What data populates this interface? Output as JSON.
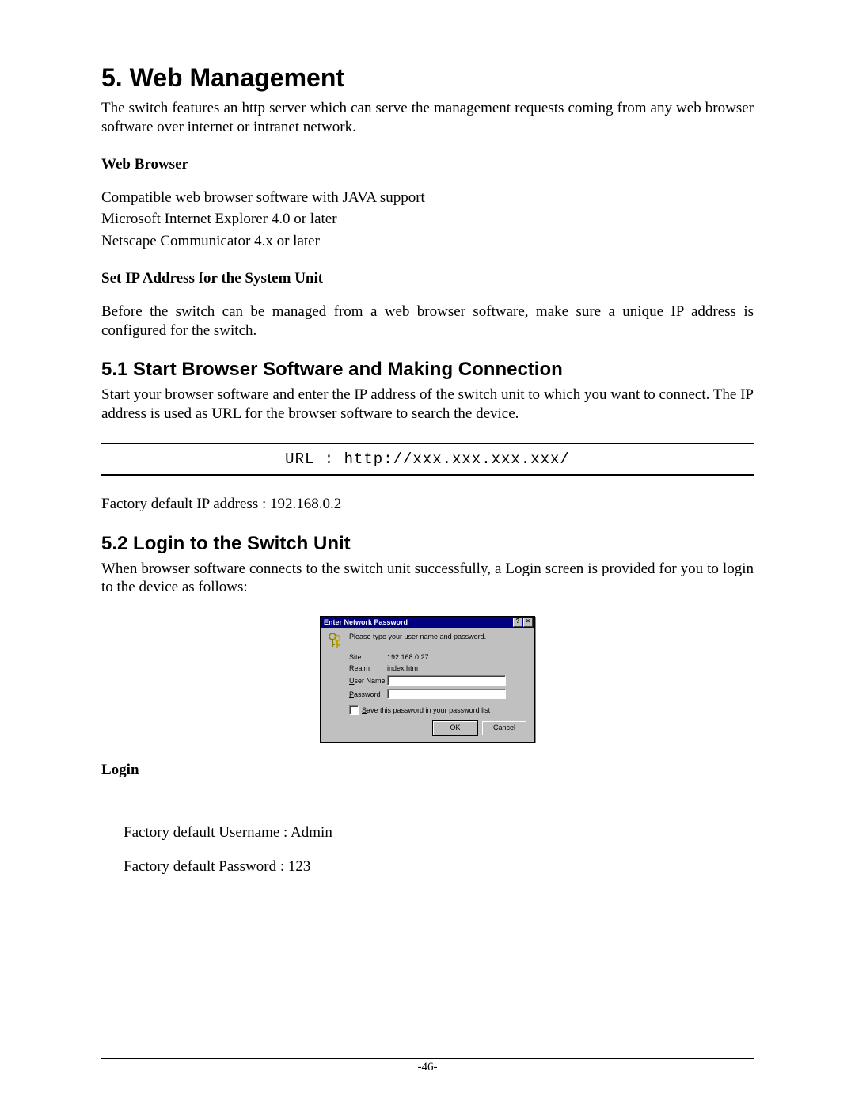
{
  "h1": "5. Web Management",
  "intro": "The switch features an http server which can serve the management requests coming from any web browser software over internet or intranet network.",
  "sec_web_browser": {
    "heading": "Web Browser",
    "line1": "Compatible web browser software with JAVA support",
    "line2": "Microsoft Internet Explorer 4.0 or later",
    "line3": "Netscape Communicator 4.x or later"
  },
  "sec_set_ip": {
    "heading": "Set IP Address for the System Unit",
    "body": "Before the switch can be managed from a web browser software, make sure a unique IP address is configured for the switch."
  },
  "h2_51": "5.1 Start Browser Software and Making Connection",
  "p_51": "Start your browser software and enter the IP address of the switch unit to which you want to connect. The IP address is used as URL for the browser software to search the device.",
  "url_line": "URL : http://xxx.xxx.xxx.xxx/",
  "factory_ip": "Factory default IP address : 192.168.0.2",
  "h2_52": "5.2 Login to the Switch Unit",
  "p_52": "When browser software connects to the switch unit successfully, a Login screen is provided for you to login to the device as follows:",
  "dialog": {
    "title": "Enter Network Password",
    "help_btn": "?",
    "close_btn": "×",
    "prompt": "Please type your user name and password.",
    "site_label": "Site:",
    "site_value": "192.168.0.27",
    "realm_label": "Realm",
    "realm_value": "index.htm",
    "username_label_u": "U",
    "username_label_rest": "ser Name",
    "password_label_p": "P",
    "password_label_rest": "assword",
    "save_label_s": "S",
    "save_label_rest": "ave this password in your password list",
    "ok": "OK",
    "cancel": "Cancel"
  },
  "login_heading": "Login",
  "login_line1": "Factory default Username : Admin",
  "login_line2": "Factory default Password : 123",
  "page_number": "-46-"
}
